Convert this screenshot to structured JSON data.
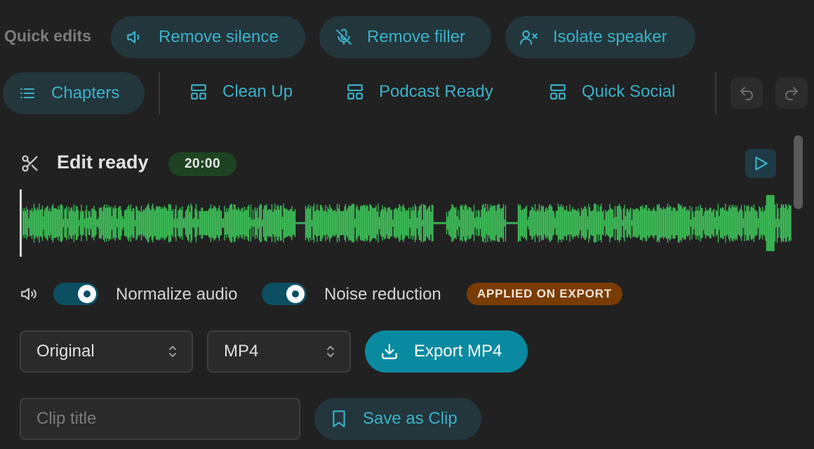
{
  "quick_edits": {
    "label": "Quick edits",
    "items": [
      {
        "label": "Remove silence",
        "icon": "speaker-icon"
      },
      {
        "label": "Remove filler",
        "icon": "mic-off-icon"
      },
      {
        "label": "Isolate speaker",
        "icon": "user-x-icon"
      }
    ]
  },
  "presets": {
    "chapters": {
      "label": "Chapters",
      "icon": "list-icon"
    },
    "items": [
      {
        "label": "Clean Up",
        "icon": "layout-icon"
      },
      {
        "label": "Podcast Ready",
        "icon": "layout-icon"
      },
      {
        "label": "Quick Social",
        "icon": "layout-icon"
      }
    ],
    "undo_icon": "undo-icon",
    "redo_icon": "redo-icon"
  },
  "editor": {
    "title": "Edit ready",
    "duration": "20:00",
    "title_icon": "scissors-icon",
    "play_icon": "play-icon",
    "waveform_color": "#3fc35a"
  },
  "audio": {
    "normalize": {
      "label": "Normalize audio",
      "on": true
    },
    "noise": {
      "label": "Noise reduction",
      "on": true
    },
    "badge": "APPLIED ON EXPORT"
  },
  "export": {
    "quality": "Original",
    "format": "MP4",
    "button_label": "Export MP4"
  },
  "clip": {
    "placeholder": "Clip title",
    "value": "",
    "save_label": "Save as Clip"
  },
  "colors": {
    "accent": "#3bb1c9",
    "export_button": "#0a8aa1",
    "badge_bg": "#7a3c06",
    "time_badge_bg": "#1d4322",
    "toggle_on": "#0c4f63"
  }
}
